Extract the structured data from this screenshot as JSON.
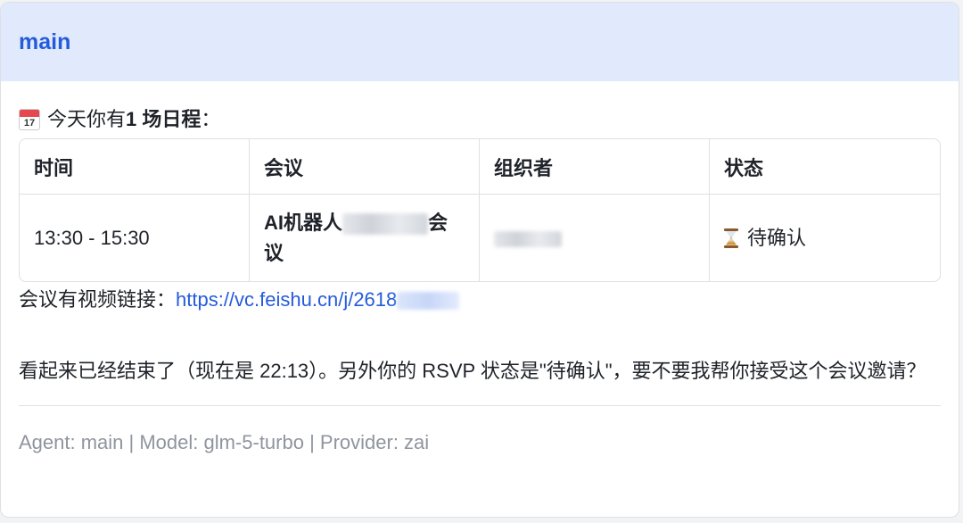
{
  "header": {
    "title": "main",
    "accent_color": "#245bdb",
    "background_color": "#e1eafc"
  },
  "intro": {
    "icon": "calendar-icon",
    "icon_number": "17",
    "prefix": "今天你有 ",
    "count": "1 场日程",
    "suffix": "："
  },
  "table": {
    "headers": [
      "时间",
      "会议",
      "组织者",
      "状态"
    ],
    "rows": [
      {
        "time": "13:30 - 15:30",
        "meeting_visible_start": "AI机器人",
        "meeting_visible_end": "会",
        "meeting_line2": "议",
        "status_icon": "hourglass-icon",
        "status": "待确认"
      }
    ]
  },
  "link": {
    "label": "会议有视频链接：",
    "url_text": "https://vc.feishu.cn/j/2618"
  },
  "message": {
    "text": "看起来已经结束了（现在是 22:13）。另外你的 RSVP 状态是\"待确认\"，要不要我帮你接受这个会议邀请？"
  },
  "footer": {
    "text": "Agent: main | Model: glm-5-turbo | Provider: zai"
  }
}
